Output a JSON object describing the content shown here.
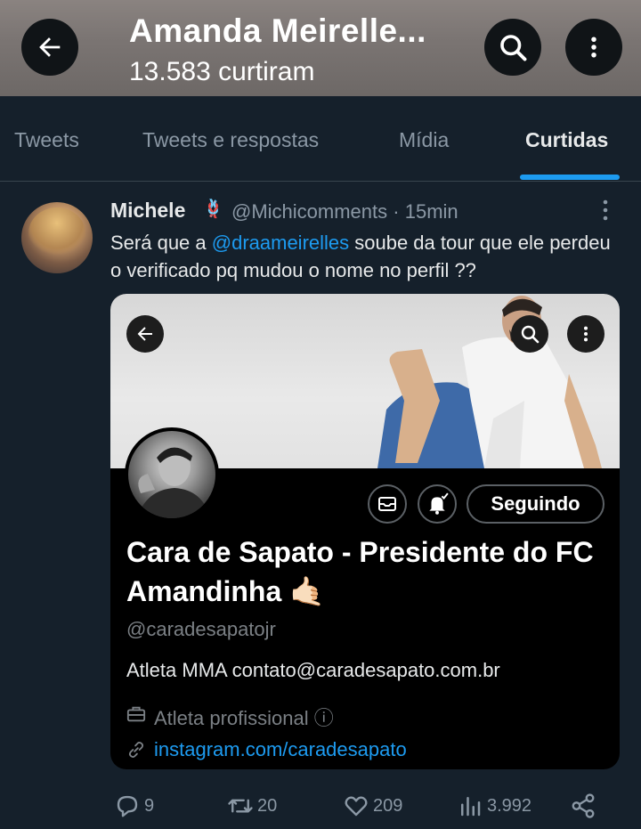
{
  "header": {
    "title": "Amanda Meirelle...",
    "subtitle": "13.583 curtiram",
    "icons": [
      "back-arrow-icon",
      "search-icon",
      "more-vertical-icon"
    ]
  },
  "tabs": [
    {
      "label": "Tweets",
      "active": false
    },
    {
      "label": "Tweets e respostas",
      "active": false
    },
    {
      "label": "Mídia",
      "active": false
    },
    {
      "label": "Curtidas",
      "active": true
    }
  ],
  "tweet": {
    "author_name": "Michele",
    "author_badge": "🪢",
    "handle": "@Michicomments",
    "separator": "·",
    "time": "15min",
    "text_before": "Será que a ",
    "mention": "@draameirelles",
    "text_after": " soube da tour que ele perdeu o verificado pq mudou o nome no perfil ??",
    "embed": {
      "follow_label": "Seguindo",
      "profile_name": "Cara de Sapato - Presidente do FC Amandinha 🤙🏻",
      "profile_handle": "@caradesapatojr",
      "bio": "Atleta MMA contato@caradesapato.com.br",
      "category": "Atleta profissional ⓘ",
      "link": "instagram.com/caradesapato"
    },
    "actions": {
      "replies": "9",
      "retweets": "20",
      "likes": "209",
      "views": "3.992"
    }
  },
  "colors": {
    "background": "#15202b",
    "accent": "#1d9bf0",
    "muted": "#8b98a5",
    "text": "#e7e9ea"
  }
}
